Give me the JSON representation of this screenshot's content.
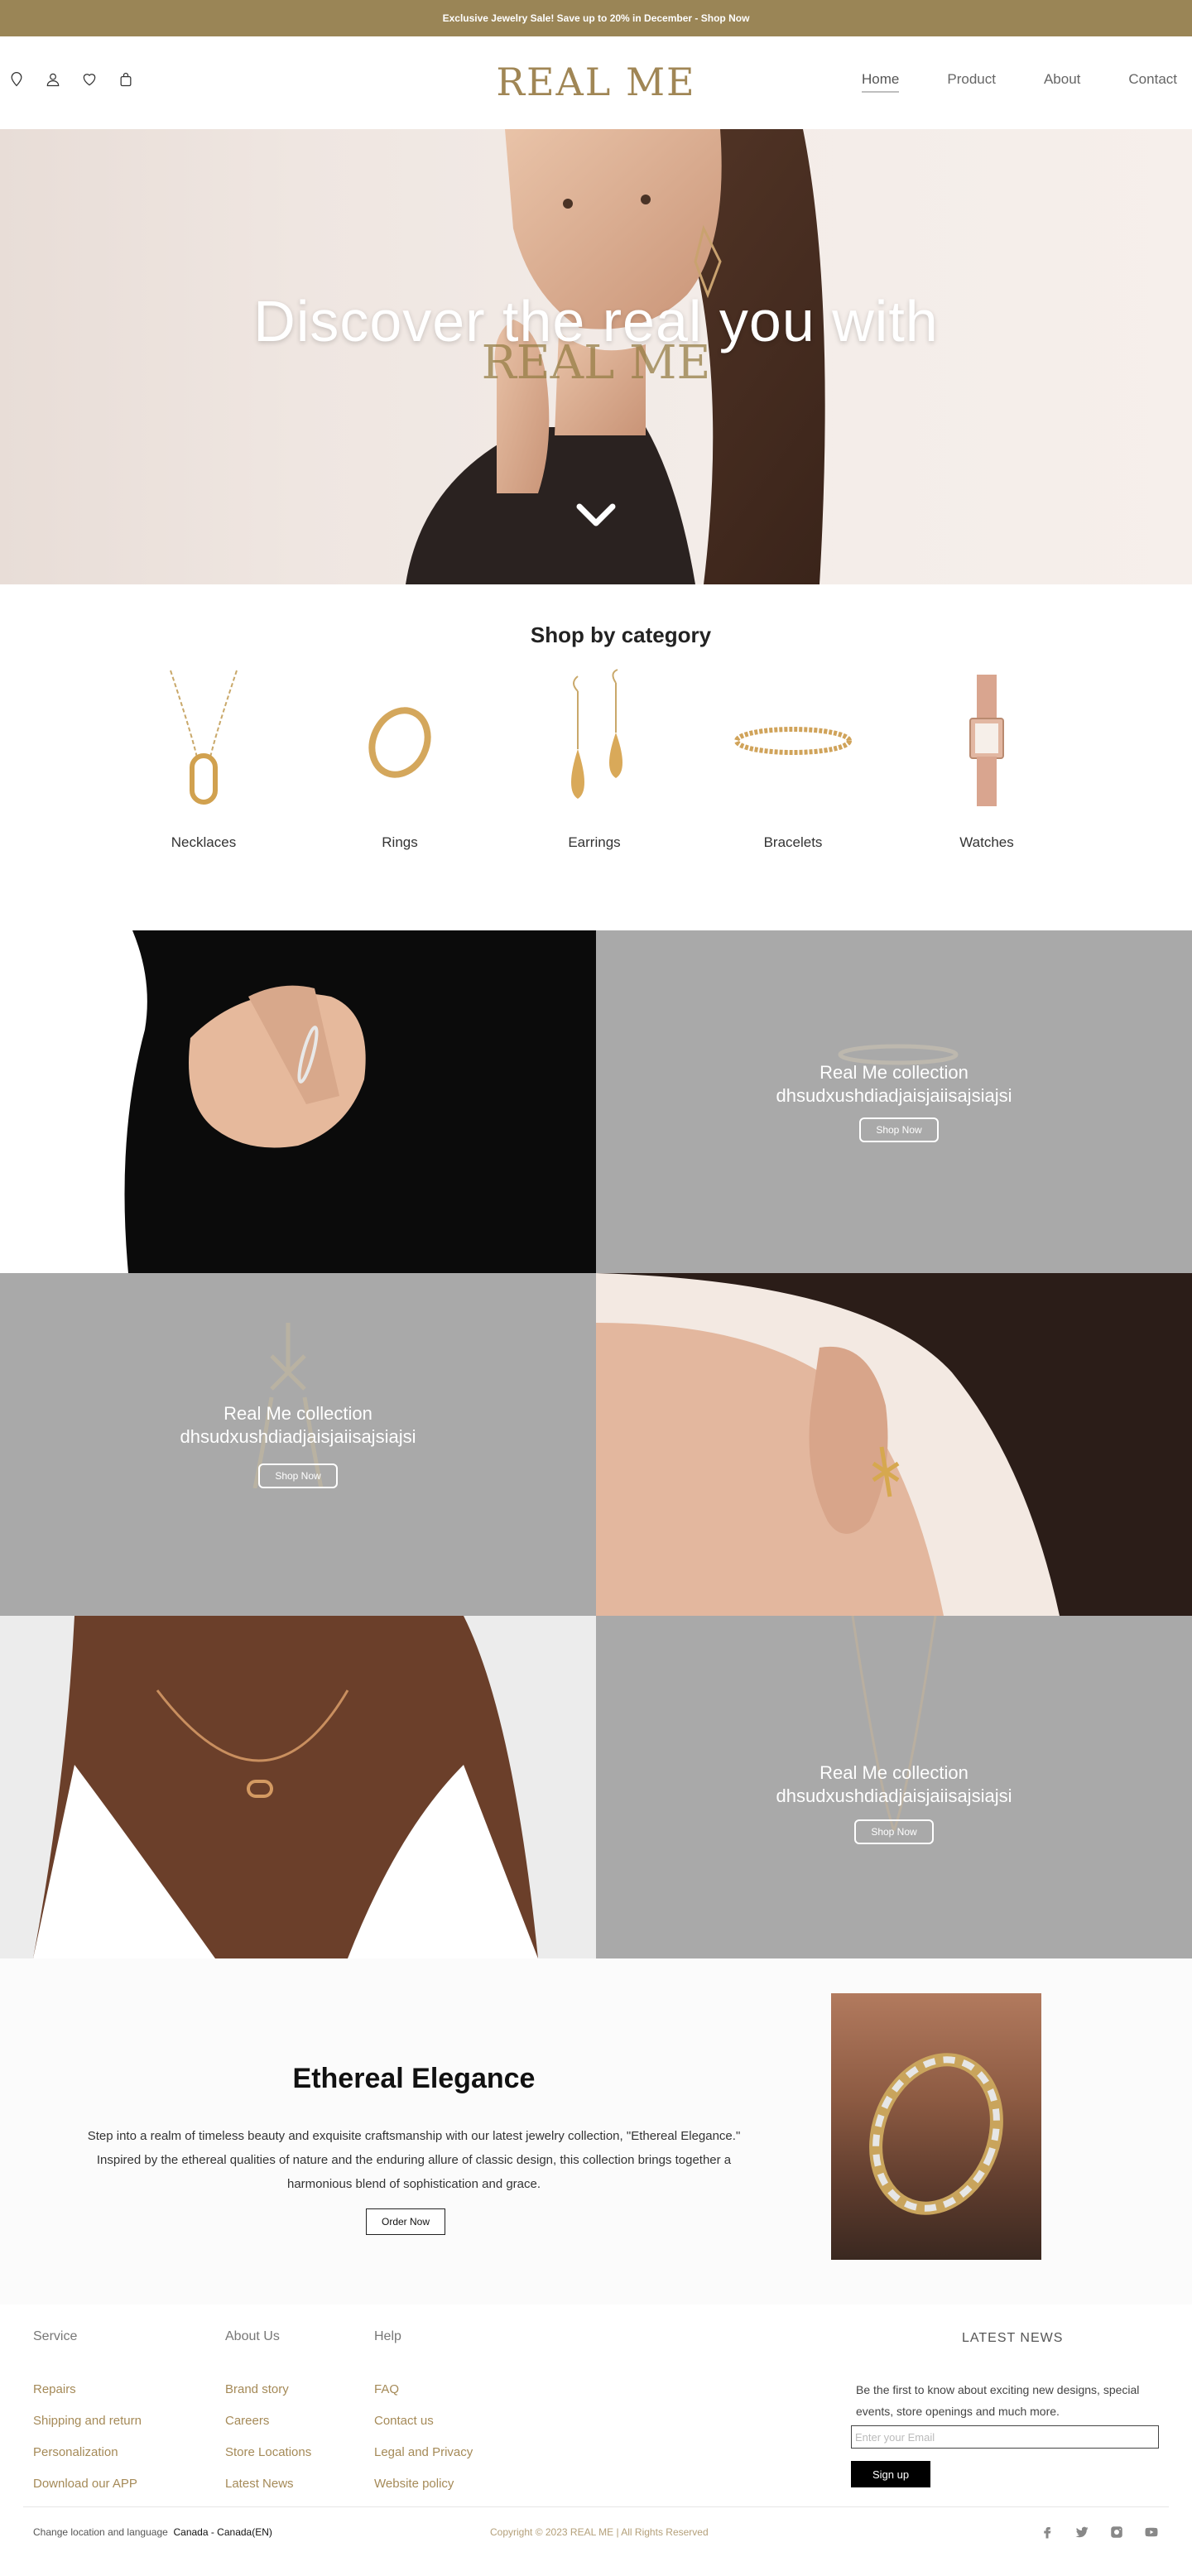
{
  "announcement": {
    "text": "Exclusive Jewelry Sale! Save up to 20% in December - Shop Now"
  },
  "header": {
    "logo": "REAL ME",
    "icons": [
      "location-icon",
      "user-icon",
      "heart-icon",
      "bag-icon"
    ],
    "nav": [
      {
        "label": "Home",
        "active": true
      },
      {
        "label": "Product",
        "active": false
      },
      {
        "label": "About",
        "active": false
      },
      {
        "label": "Contact",
        "active": false
      }
    ]
  },
  "hero": {
    "title": "Discover the real you with",
    "brand": "REAL ME"
  },
  "categories": {
    "title": "Shop by category",
    "items": [
      {
        "label": "Necklaces"
      },
      {
        "label": "Rings"
      },
      {
        "label": "Earrings"
      },
      {
        "label": "Bracelets"
      },
      {
        "label": "Watches"
      }
    ]
  },
  "collections": [
    {
      "title": "Real Me collection",
      "subtitle": "dhsudxushdiadjaisjaiisajsiajsi",
      "button": "Shop Now"
    },
    {
      "title": "Real Me collection",
      "subtitle": "dhsudxushdiadjaisjaiisajsiajsi",
      "button": "Shop Now"
    },
    {
      "title": "Real Me collection",
      "subtitle": "dhsudxushdiadjaisjaiisajsiajsi",
      "button": "Shop Now"
    }
  ],
  "feature": {
    "title": "Ethereal Elegance",
    "body": "Step into a realm of timeless beauty and exquisite craftsmanship with our latest jewelry collection, \"Ethereal Elegance.\" Inspired by the ethereal qualities of nature and the enduring allure of classic design, this collection brings together a harmonious blend of sophistication and grace.",
    "button": "Order Now"
  },
  "footer": {
    "columns": [
      {
        "heading": "Service",
        "links": [
          "Repairs",
          "Shipping and return",
          "Personalization",
          "Download our APP"
        ]
      },
      {
        "heading": "About Us",
        "links": [
          "Brand story",
          "Careers",
          "Store Locations",
          "Latest News"
        ]
      },
      {
        "heading": "Help",
        "links": [
          "FAQ",
          "Contact us",
          "Legal and Privacy",
          "Website policy"
        ]
      }
    ],
    "news": {
      "heading": "LATEST NEWS",
      "text": "Be the first to know about exciting new designs, special events, store openings and much more.",
      "placeholder": "Enter your Email",
      "button": "Sign up"
    },
    "locale_label": "Change location and language",
    "locale_value": "Canada - Canada(EN)",
    "copyright": "Copyright © 2023 REAL ME | All Rights Reserved",
    "social": [
      "facebook-icon",
      "twitter-icon",
      "instagram-icon",
      "youtube-icon"
    ]
  },
  "colors": {
    "brand_gold": "#9a8556",
    "link_gold": "#a58a58",
    "tile_gray": "#a9a9a9",
    "button_black": "#000000"
  }
}
